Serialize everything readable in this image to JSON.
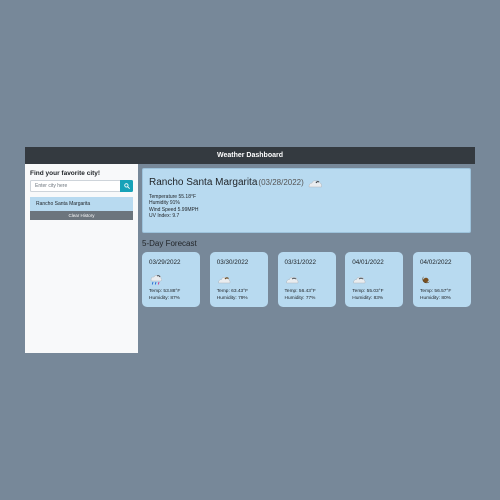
{
  "header": {
    "title": "Weather Dashboard"
  },
  "sidebar": {
    "heading": "Find your favorite city!",
    "search_placeholder": "Enter city here",
    "history": [
      "Rancho Santa Margarita"
    ],
    "clear_label": "Clear History"
  },
  "current": {
    "city": "Rancho Santa Margarita",
    "date": "(03/28/2022)",
    "icon": "partly-cloudy-icon",
    "temperature": "Temperature 55.18°F",
    "humidity": "Humidity 91%",
    "wind": "Wind Speed 5.99MPH",
    "uv": "UV Index: 9.7"
  },
  "forecast": {
    "title": "5-Day Forecast",
    "days": [
      {
        "date": "03/29/2022",
        "icon": "rain-cloud-icon",
        "temp": "Temp: 53.88°F",
        "humidity": "Humidity: 87%"
      },
      {
        "date": "03/30/2022",
        "icon": "partly-cloudy-icon",
        "temp": "Temp: 63.43°F",
        "humidity": "Humidity: 79%"
      },
      {
        "date": "03/31/2022",
        "icon": "cloud-icon",
        "temp": "Temp: 56.43°F",
        "humidity": "Humidity: 77%"
      },
      {
        "date": "04/01/2022",
        "icon": "cloud-icon",
        "temp": "Temp: 55.03°F",
        "humidity": "Humidity: 83%"
      },
      {
        "date": "04/02/2022",
        "icon": "moon-icon",
        "temp": "Temp: 56.57°F",
        "humidity": "Humidity: 80%"
      }
    ]
  }
}
